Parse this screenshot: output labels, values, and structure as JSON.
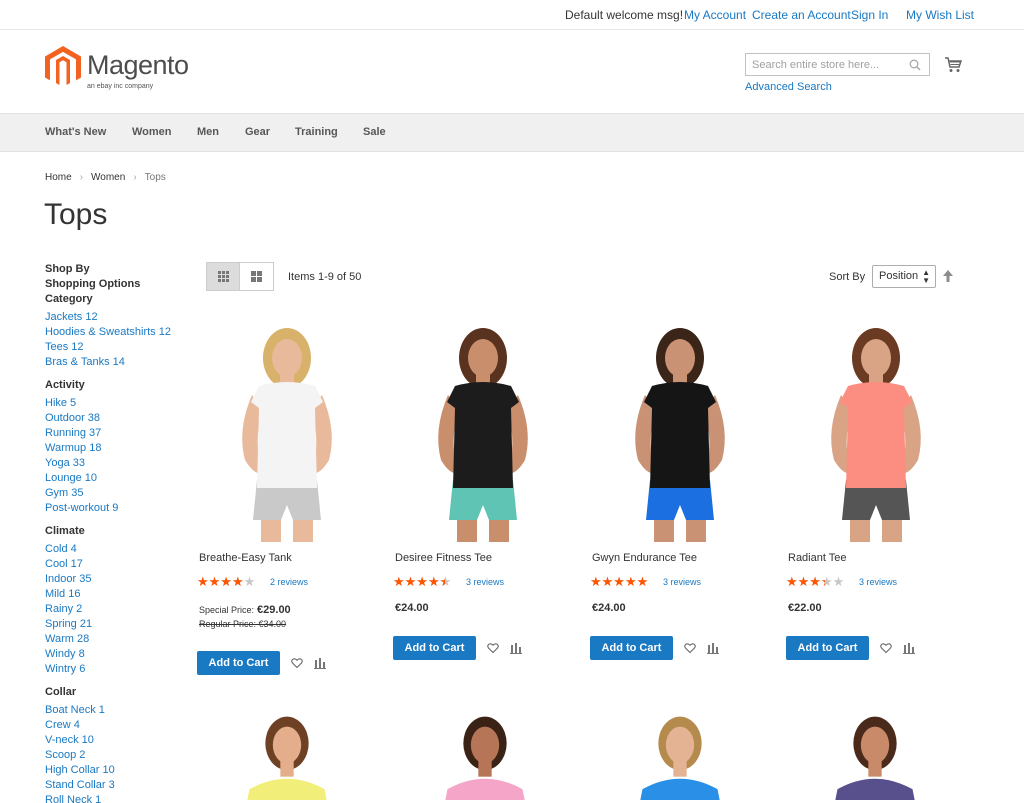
{
  "topbar": {
    "welcome": "Default welcome msg!",
    "my_account": "My Account",
    "create_account": "Create an Account",
    "sign_in": "Sign In",
    "wish_list": "My Wish List"
  },
  "header": {
    "logo_text": "Magento",
    "logo_sub": "an ebay inc company",
    "search_placeholder": "Search entire store here...",
    "advanced_search": "Advanced Search"
  },
  "nav": [
    "What's New",
    "Women",
    "Men",
    "Gear",
    "Training",
    "Sale"
  ],
  "breadcrumb": {
    "home": "Home",
    "women": "Women",
    "current": "Tops"
  },
  "page_title": "Tops",
  "sidebar": {
    "shop_by": "Shop By",
    "shopping_options": "Shopping Options",
    "groups": [
      {
        "title": "Category",
        "items": [
          "Jackets 12",
          "Hoodies & Sweatshirts 12",
          "Tees 12",
          "Bras & Tanks 14"
        ]
      },
      {
        "title": "Activity",
        "items": [
          "Hike 5",
          "Outdoor 38",
          "Running 37",
          "Warmup 18",
          "Yoga 33",
          "Lounge 10",
          "Gym 35",
          "Post-workout 9"
        ]
      },
      {
        "title": "Climate",
        "items": [
          "Cold 4",
          "Cool 17",
          "Indoor 35",
          "Mild 16",
          "Rainy 2",
          "Spring 21",
          "Warm 28",
          "Windy 8",
          "Wintry 6"
        ]
      },
      {
        "title": "Collar",
        "items": [
          "Boat Neck 1",
          "Crew 4",
          "V-neck 10",
          "Scoop 2",
          "High Collar 10",
          "Stand Collar 3",
          "Roll Neck 1"
        ]
      }
    ]
  },
  "toolbar": {
    "amount": "Items 1-9 of 50",
    "sort_label": "Sort By",
    "sort_value": "Position"
  },
  "products": [
    {
      "name": "Breathe-Easy Tank",
      "rating": 0.7,
      "reviews": "2 reviews",
      "special_label": "Special Price:",
      "special_price": "€29.00",
      "regular": "Regular Price: €34.00",
      "price": "",
      "add_to_cart": "Add to Cart",
      "shirt": "#f4f4f4",
      "bottom": "#c9c9c9",
      "skin": "#e8b99a",
      "hair": "#d8b26a"
    },
    {
      "name": "Desiree Fitness Tee",
      "rating": 0.8,
      "reviews": "3 reviews",
      "special_label": "",
      "special_price": "",
      "regular": "",
      "price": "€24.00",
      "add_to_cart": "Add to Cart",
      "shirt": "#1c1c1c",
      "bottom": "#5fc4b3",
      "skin": "#c98e6c",
      "hair": "#5a3220"
    },
    {
      "name": "Gwyn Endurance Tee",
      "rating": 0.9,
      "reviews": "3 reviews",
      "special_label": "",
      "special_price": "",
      "regular": "",
      "price": "€24.00",
      "add_to_cart": "Add to Cart",
      "shirt": "#151515",
      "bottom": "#1c6fe0",
      "skin": "#c99274",
      "hair": "#3b2418"
    },
    {
      "name": "Radiant Tee",
      "rating": 0.6,
      "reviews": "3 reviews",
      "special_label": "",
      "special_price": "",
      "regular": "",
      "price": "€22.00",
      "add_to_cart": "Add to Cart",
      "shirt": "#fb8e80",
      "bottom": "#555555",
      "skin": "#d9a485",
      "hair": "#6b3a22"
    }
  ],
  "products_row2": [
    {
      "shirt": "#f2ee7a",
      "skin": "#e4ae8c",
      "hair": "#6e4125"
    },
    {
      "shirt": "#f5a6c8",
      "skin": "#b57556",
      "hair": "#3a2215"
    },
    {
      "shirt": "#2a8fe6",
      "skin": "#e3b394",
      "hair": "#b58a4d"
    },
    {
      "shirt": "#58508c",
      "skin": "#c88a69",
      "hair": "#4a2b1b"
    }
  ],
  "colors": {
    "link": "#1979c3",
    "star": "#ff5501",
    "nav_bg": "#f0f0f0"
  }
}
